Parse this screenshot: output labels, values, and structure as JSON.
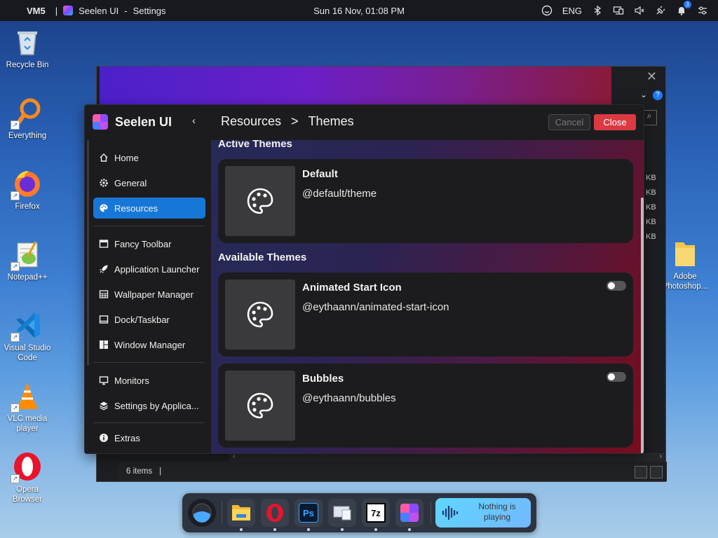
{
  "topbar": {
    "workspace": "VM5",
    "separator": "|",
    "app_name": "Seelen UI",
    "dash": "-",
    "window_title": "Settings",
    "datetime": "Sun 16 Nov, 01:08 PM",
    "language": "ENG",
    "notification_count": "3"
  },
  "desktop": {
    "icons": [
      {
        "label": "Recycle Bin"
      },
      {
        "label": "Everything"
      },
      {
        "label": "Firefox"
      },
      {
        "label": "Notepad++"
      },
      {
        "label": "Visual Studio Code"
      },
      {
        "label": "VLC media player"
      },
      {
        "label": "Opera Browser"
      },
      {
        "label": "Adobe Photoshop..."
      }
    ]
  },
  "explorer": {
    "close_glyph": "✕",
    "chevron": "⌄",
    "help": "?",
    "size_unit": "KB",
    "status": "6 items",
    "status_cursor": "|"
  },
  "settings": {
    "brand": "Seelen UI",
    "collapse_glyph": "‹",
    "breadcrumb": [
      "Resources",
      ">",
      "Themes"
    ],
    "cancel_label": "Cancel",
    "close_label": "Close",
    "nav": [
      {
        "label": "Home",
        "icon": "home-icon"
      },
      {
        "label": "General",
        "icon": "gear-icon"
      },
      {
        "label": "Resources",
        "icon": "palette-icon",
        "active": true
      },
      {
        "label": "Fancy Toolbar",
        "icon": "toolbar-icon"
      },
      {
        "label": "Application Launcher",
        "icon": "rocket-icon"
      },
      {
        "label": "Wallpaper Manager",
        "icon": "wallpaper-icon"
      },
      {
        "label": "Dock/Taskbar",
        "icon": "dock-icon"
      },
      {
        "label": "Window Manager",
        "icon": "windows-grid-icon"
      },
      {
        "label": "Monitors",
        "icon": "monitor-icon"
      },
      {
        "label": "Settings by Applica...",
        "icon": "layers-icon"
      },
      {
        "label": "Extras",
        "icon": "info-icon"
      }
    ],
    "sections": {
      "active": "Active Themes",
      "available": "Available Themes"
    },
    "themes": [
      {
        "name": "Default",
        "id": "@default/theme",
        "enabled": true
      },
      {
        "name": "Animated Start Icon",
        "id": "@eythaann/animated-start-icon",
        "enabled": false
      },
      {
        "name": "Bubbles",
        "id": "@eythaann/bubbles",
        "enabled": false
      }
    ]
  },
  "dock": {
    "media_text": "Nothing is playing",
    "items": [
      "seelen-icon",
      "file-explorer-icon",
      "opera-icon",
      "photoshop-icon",
      "devices-icon",
      "7zip-icon",
      "seelen-settings-icon"
    ],
    "ps_label": "Ps",
    "sevenzip_label": "7z"
  },
  "colors": {
    "accent": "#1777d9",
    "close_button": "#dc3a43"
  }
}
